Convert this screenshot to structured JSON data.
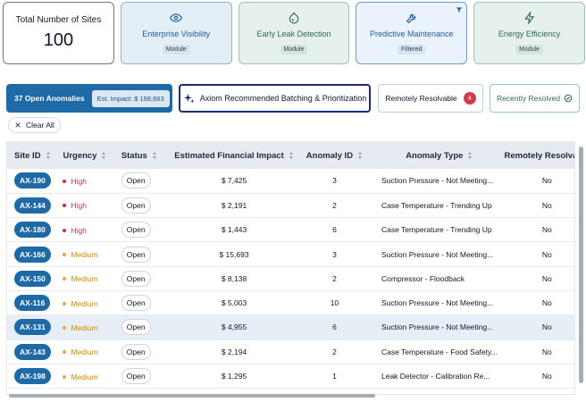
{
  "total_card": {
    "label": "Total Number of Sites",
    "value": "100"
  },
  "modules": [
    {
      "name": "Enterprise Visibility",
      "badge": "Module",
      "icon": "eye-icon"
    },
    {
      "name": "Early Leak Detection",
      "badge": "Module",
      "icon": "droplet-icon"
    },
    {
      "name": "Predictive Maintenance",
      "badge": "Filtered",
      "icon": "wrench-icon"
    },
    {
      "name": "Energy Efficiency",
      "badge": "Module",
      "icon": "lightning-icon"
    }
  ],
  "actions": {
    "open_anomalies": "37 Open Anomalies",
    "est_impact": "Est. Impact: $ 158,663",
    "axiom": "Axiom Recommended Batching & Prioritization",
    "remotely_resolvable": "Remotely Resolvable",
    "remotely_resolvable_count": "4",
    "recently_resolved": "Recently Resolved"
  },
  "clear_all": "Clear All",
  "table": {
    "headers": [
      "Site ID",
      "Urgency",
      "Status",
      "Estimated Financial Impact",
      "Anomaly ID",
      "Anomaly Type",
      "Remotely Resolvable"
    ],
    "rows": [
      {
        "site": "AX-190",
        "urgency": "High",
        "status": "Open",
        "impact": "$ 7,425",
        "anomaly_id": "3",
        "type": "Suction Pressure - Not Meeting...",
        "remote": "No"
      },
      {
        "site": "AX-144",
        "urgency": "High",
        "status": "Open",
        "impact": "$ 2,191",
        "anomaly_id": "2",
        "type": "Case Temperature - Trending Up",
        "remote": "No"
      },
      {
        "site": "AX-180",
        "urgency": "High",
        "status": "Open",
        "impact": "$ 1,443",
        "anomaly_id": "6",
        "type": "Case Temperature - Trending Up",
        "remote": "No"
      },
      {
        "site": "AX-166",
        "urgency": "Medium",
        "status": "Open",
        "impact": "$ 15,693",
        "anomaly_id": "3",
        "type": "Suction Pressure - Not Meeting...",
        "remote": "No"
      },
      {
        "site": "AX-150",
        "urgency": "Medium",
        "status": "Open",
        "impact": "$ 8,138",
        "anomaly_id": "2",
        "type": "Compressor - Floodback",
        "remote": "No"
      },
      {
        "site": "AX-116",
        "urgency": "Medium",
        "status": "Open",
        "impact": "$ 5,003",
        "anomaly_id": "10",
        "type": "Suction Pressure - Not Meeting...",
        "remote": "No"
      },
      {
        "site": "AX-131",
        "urgency": "Medium",
        "status": "Open",
        "impact": "$ 4,955",
        "anomaly_id": "6",
        "type": "Suction Pressure - Not Meeting...",
        "remote": "No"
      },
      {
        "site": "AX-143",
        "urgency": "Medium",
        "status": "Open",
        "impact": "$ 2,194",
        "anomaly_id": "2",
        "type": "Case Temperature - Food Safety...",
        "remote": "No"
      },
      {
        "site": "AX-198",
        "urgency": "Medium",
        "status": "Open",
        "impact": "$ 1,295",
        "anomaly_id": "1",
        "type": "Leak Detector - Calibration Re...",
        "remote": "No"
      }
    ]
  },
  "colors": {
    "primary": "#1e6aa6",
    "high": "#c9303f",
    "medium": "#c58a16",
    "axiom_border": "#1e2a78",
    "resolved": "#2f6b52"
  }
}
